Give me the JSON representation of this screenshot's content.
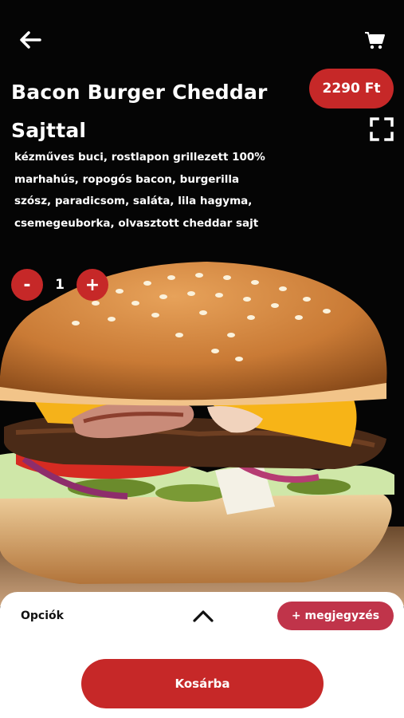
{
  "product": {
    "title": "Bacon Burger Cheddar Sajttal",
    "price": "2290 Ft",
    "description": "kézműves buci, rostlapon grillezett 100% marhahús, ropogós bacon, burgerilla szósz, paradicsom, saláta, lila hagyma, csemegeuborka, olvasztott cheddar sajt"
  },
  "quantity": {
    "minus_label": "-",
    "value": "1",
    "plus_label": "+"
  },
  "sheet": {
    "options_label": "Opciók",
    "note_label": "+ megjegyzés",
    "add_to_cart_label": "Kosárba"
  },
  "icons": {
    "back": "arrow-left-icon",
    "cart": "shopping-cart-icon",
    "expand": "fullscreen-icon",
    "chevron": "chevron-up-icon"
  },
  "colors": {
    "accent": "#c62828",
    "note_button": "#c0344a",
    "background": "#050505"
  }
}
